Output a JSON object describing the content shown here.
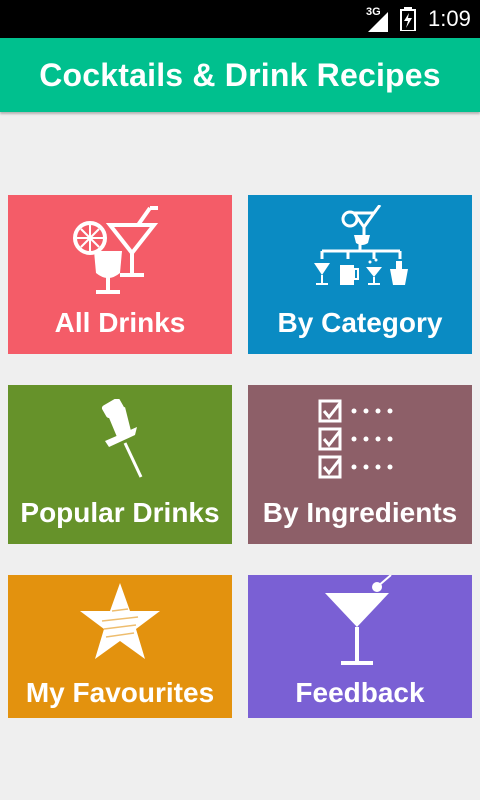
{
  "status_bar": {
    "network": "3G",
    "time": "1:09"
  },
  "app_bar": {
    "title": "Cocktails & Drink Recipes"
  },
  "tiles": [
    {
      "label": "All Drinks",
      "color": "#f45c68",
      "icon": "cocktail-glasses-icon"
    },
    {
      "label": "By Category",
      "color": "#0a8bc3",
      "icon": "category-tree-icon"
    },
    {
      "label": "Popular Drinks",
      "color": "#66922a",
      "icon": "pushpin-icon"
    },
    {
      "label": "By Ingredients",
      "color": "#8d5f68",
      "icon": "checklist-icon"
    },
    {
      "label": "My Favourites",
      "color": "#e3920e",
      "icon": "star-icon"
    },
    {
      "label": "Feedback",
      "color": "#7a60d4",
      "icon": "martini-icon"
    }
  ],
  "colors": {
    "app_bar": "#00c08e",
    "background": "#efefef"
  }
}
